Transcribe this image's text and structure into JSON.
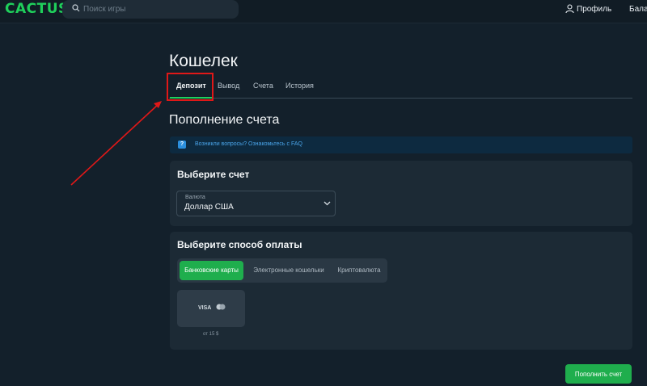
{
  "header": {
    "logo_text": "CACTUS",
    "search_placeholder": "Поиск игры",
    "profile_label": "Профиль",
    "balance_label": "Бала"
  },
  "page": {
    "title": "Кошелек",
    "tabs": [
      {
        "label": "Депозит",
        "active": true
      },
      {
        "label": "Вывод",
        "active": false
      },
      {
        "label": "Счета",
        "active": false
      },
      {
        "label": "История",
        "active": false
      }
    ]
  },
  "deposit": {
    "section_title": "Пополнение счета",
    "faq_text": "Возникли вопросы? Ознакомьтесь с FAQ",
    "account": {
      "title": "Выберите счет",
      "currency_label": "Валюта",
      "currency_value": "Доллар США"
    },
    "payment": {
      "title": "Выберите способ оплаты",
      "tabs": [
        {
          "label": "Банковские карты",
          "active": true
        },
        {
          "label": "Электронные кошельки",
          "active": false
        },
        {
          "label": "Криптовалюта",
          "active": false
        }
      ],
      "method_label": "VISA",
      "method_note": "от 15 $"
    },
    "submit_label": "Пополнить счет"
  },
  "colors": {
    "background": "#13202b",
    "accent": "#1fae4d",
    "highlight_box": "#e01818"
  }
}
